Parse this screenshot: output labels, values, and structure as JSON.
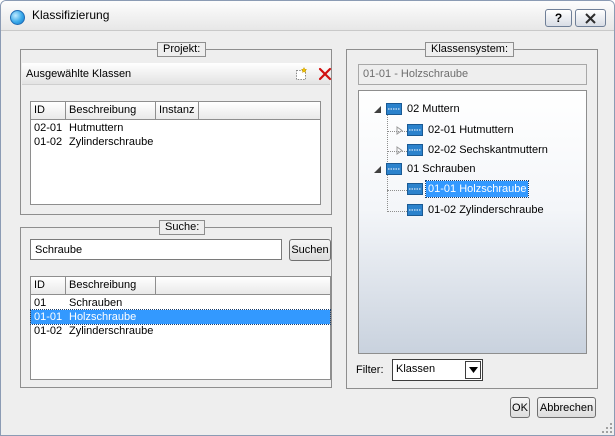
{
  "window": {
    "title": "Klassifizierung",
    "help_label": "?"
  },
  "projekt": {
    "legend": "Projekt:",
    "header_label": "Ausgewählte Klassen",
    "columns": [
      "ID",
      "Beschreibung",
      "Instanz"
    ],
    "rows": [
      {
        "id": "02-01",
        "desc": "Hutmuttern",
        "instanz": ""
      },
      {
        "id": "01-02",
        "desc": "Zylinderschraube",
        "instanz": ""
      }
    ]
  },
  "suche": {
    "legend": "Suche:",
    "query": "Schraube",
    "button_label": "Suchen",
    "columns": [
      "ID",
      "Beschreibung"
    ],
    "rows": [
      {
        "id": "01",
        "desc": "Schrauben",
        "selected": false
      },
      {
        "id": "01-01",
        "desc": "Holzschraube",
        "selected": true
      },
      {
        "id": "01-02",
        "desc": "Zylinderschraube",
        "selected": false
      }
    ]
  },
  "klassensystem": {
    "legend": "Klassensystem:",
    "current": "01-01 - Holzschraube",
    "tree": [
      {
        "label": "02 Muttern",
        "level": 0,
        "expanded": true
      },
      {
        "label": "02-01 Hutmuttern",
        "level": 1,
        "has_children": true
      },
      {
        "label": "02-02 Sechskantmuttern",
        "level": 1,
        "has_children": true
      },
      {
        "label": "01 Schrauben",
        "level": 0,
        "expanded": true
      },
      {
        "label": "01-01 Holzschraube",
        "level": 1,
        "selected": true
      },
      {
        "label": "01-02 Zylinderschraube",
        "level": 1
      }
    ],
    "filter_label": "Filter:",
    "filter_value": "Klassen"
  },
  "footer": {
    "ok_label": "OK",
    "cancel_label": "Abbrechen"
  },
  "colors": {
    "selection": "#3399ff",
    "window_bg": "#eeeeee",
    "delete": "#d01010"
  }
}
